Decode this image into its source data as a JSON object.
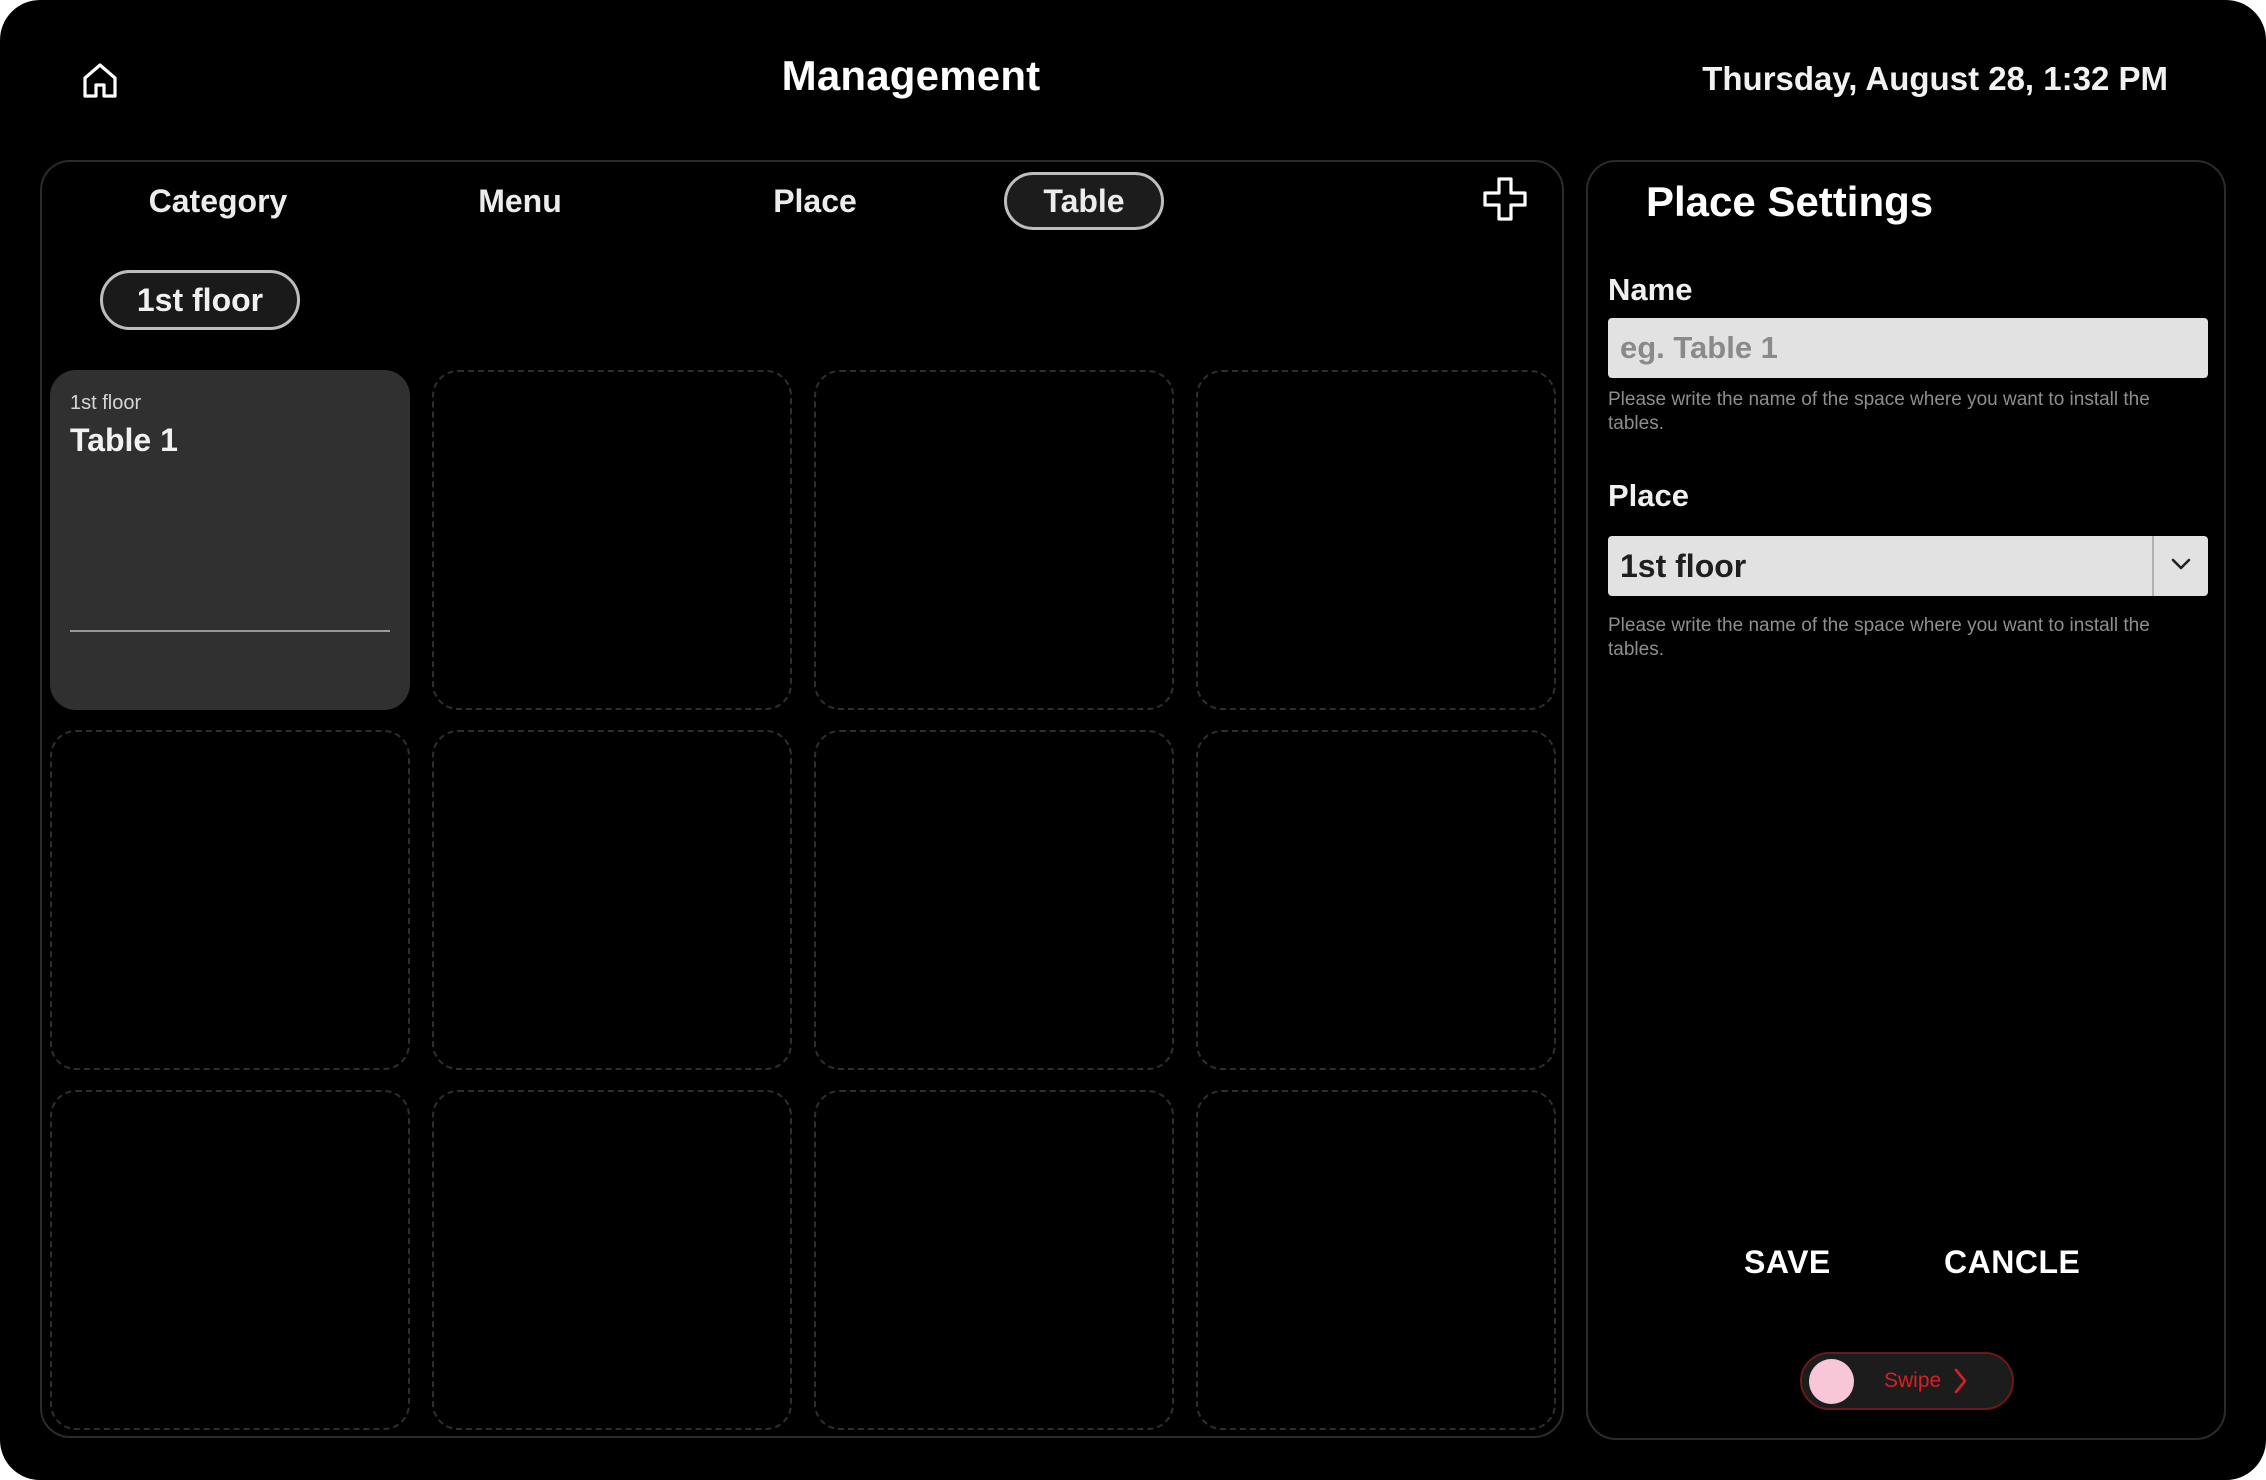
{
  "header": {
    "title": "Management",
    "datetime": "Thursday, August 28, 1:32 PM",
    "home_icon": "home-icon"
  },
  "tabs": [
    {
      "label": "Category",
      "active": false
    },
    {
      "label": "Menu",
      "active": false
    },
    {
      "label": "Place",
      "active": false
    },
    {
      "label": "Table",
      "active": true
    }
  ],
  "add_icon": "plus-icon",
  "place_filter": {
    "selected": "1st floor"
  },
  "tables": [
    {
      "place": "1st floor",
      "name": "Table 1"
    }
  ],
  "empty_slots": 11,
  "settings": {
    "title": "Place Settings",
    "name_label": "Name",
    "name_placeholder": "eg. Table 1",
    "name_value": "",
    "name_helper": "Please write the name of the space where you want to install the tables.",
    "place_label": "Place",
    "place_value": "1st floor",
    "place_helper": "Please write the name of the space where you want to install the tables.",
    "save_label": "SAVE",
    "cancel_label": "CANCLE",
    "swipe_label": "Swipe"
  },
  "colors": {
    "background": "#000000",
    "card": "#303030",
    "input": "#e2e2e2",
    "swipe_knob": "#f7c6d7",
    "swipe_text": "#d81f26"
  }
}
